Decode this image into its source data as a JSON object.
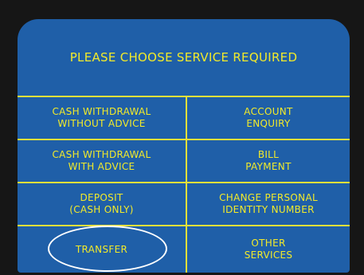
{
  "screen": {
    "title": "PLEASE CHOOSE SERVICE REQUIRED",
    "background_color": "#1f5fa8",
    "text_color": "#f2ea2a",
    "line_color": "#e8e03a"
  },
  "options": {
    "cash_without_advice": "CASH WITHDRAWAL\nWITHOUT ADVICE",
    "account_enquiry": "ACCOUNT\nENQUIRY",
    "cash_with_advice": "CASH WITHDRAWAL\nWITH ADVICE",
    "bill_payment": "BILL\nPAYMENT",
    "deposit": "DEPOSIT\n(CASH ONLY)",
    "change_pin": "CHANGE PERSONAL\nIDENTITY NUMBER",
    "transfer": "TRANSFER",
    "other_services": "OTHER\nSERVICES"
  },
  "highlighted_option": "transfer"
}
